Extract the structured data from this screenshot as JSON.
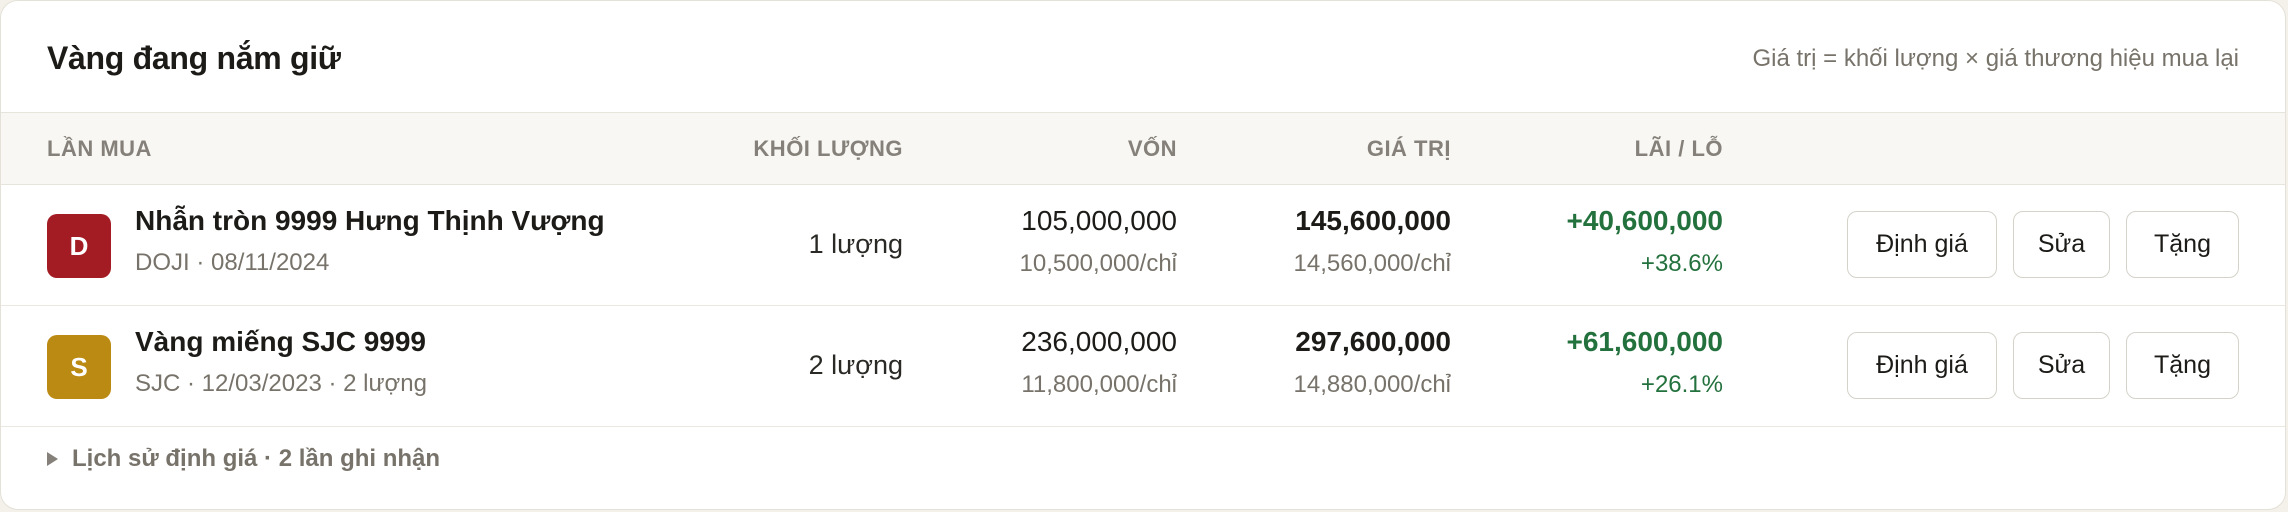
{
  "header": {
    "title": "Vàng đang nắm giữ",
    "note": "Giá trị = khối lượng × giá thương hiệu mua lại"
  },
  "columns": {
    "purchase": "LẦN MUA",
    "weight": "KHỐI LƯỢNG",
    "capital": "VỐN",
    "value": "GIÁ TRỊ",
    "profit": "LÃI / LỖ"
  },
  "rows": [
    {
      "avatar_letter": "D",
      "avatar_color": "#a31c24",
      "name": "Nhẫn tròn 9999 Hưng Thịnh Vượng",
      "meta": "DOJI · 08/11/2024",
      "weight": "1 lượng",
      "capital": "105,000,000",
      "capital_per": "10,500,000/chỉ",
      "value": "145,600,000",
      "value_per": "14,560,000/chỉ",
      "profit": "+40,600,000",
      "profit_pct": "+38.6%"
    },
    {
      "avatar_letter": "S",
      "avatar_color": "#bb8a12",
      "name": "Vàng miếng SJC 9999",
      "meta": "SJC · 12/03/2023 · 2 lượng",
      "weight": "2 lượng",
      "capital": "236,000,000",
      "capital_per": "11,800,000/chỉ",
      "value": "297,600,000",
      "value_per": "14,880,000/chỉ",
      "profit": "+61,600,000",
      "profit_pct": "+26.1%"
    }
  ],
  "actions": {
    "valuate": "Định giá",
    "edit": "Sửa",
    "gift": "Tặng"
  },
  "history": {
    "label": "Lịch sử định giá · 2 lần ghi nhận",
    "icon": "triangle-right-icon"
  },
  "colors": {
    "positive": "#23713d",
    "muted": "#77736a",
    "header_bg": "#f8f7f3"
  }
}
